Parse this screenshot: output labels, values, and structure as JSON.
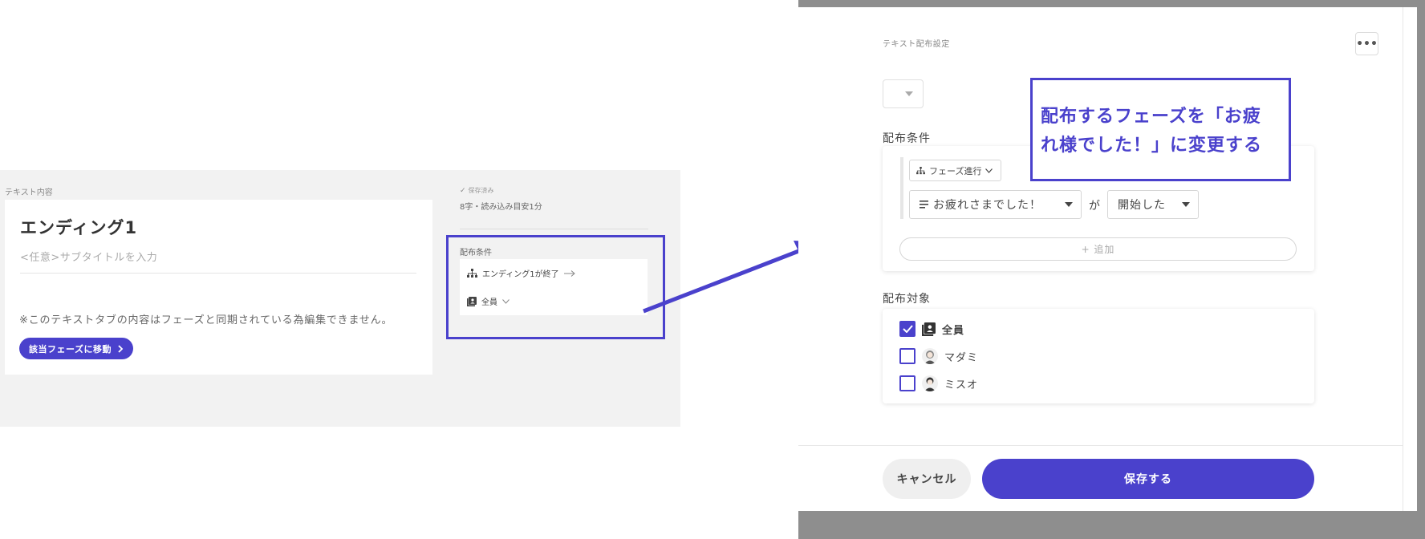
{
  "colors": {
    "accent": "#4a41cc",
    "panel_bg": "#f2f2f2"
  },
  "editor": {
    "content_label": "テキスト内容",
    "title": "エンディング1",
    "subtitle_placeholder": "<任意>サブタイトルを入力",
    "lock_note": "※このテキストタブの内容はフェーズと同期されている為編集できません。",
    "goto_phase_button": "該当フェーズに移動",
    "save_status": "保存済み",
    "char_count": "8字・読み込み目安1分",
    "conditions_label": "配布条件",
    "condition_rows": [
      {
        "icon": "hierarchy-icon",
        "label": "エンディング1が終了"
      },
      {
        "icon": "people-icon",
        "label": "全員"
      }
    ]
  },
  "modal": {
    "heading": "テキスト配布設定",
    "more_label": "•••",
    "conditions_title": "配布条件",
    "phase_type": "フェーズ進行",
    "phase_name": "お疲れさまでした！",
    "particle": "が",
    "state": "開始した",
    "add_label": "+ 追加",
    "targets_title": "配布対象",
    "targets": [
      {
        "label": "全員",
        "checked": true,
        "icon": "people-icon"
      },
      {
        "label": "マダミ",
        "checked": false,
        "icon": "avatar-female"
      },
      {
        "label": "ミスオ",
        "checked": false,
        "icon": "avatar-male"
      }
    ],
    "cancel_button": "キャンセル",
    "save_button": "保存する"
  },
  "callout": {
    "line1": "配布するフェーズを「お疲",
    "line2": "れ様でした！」に変更する"
  }
}
